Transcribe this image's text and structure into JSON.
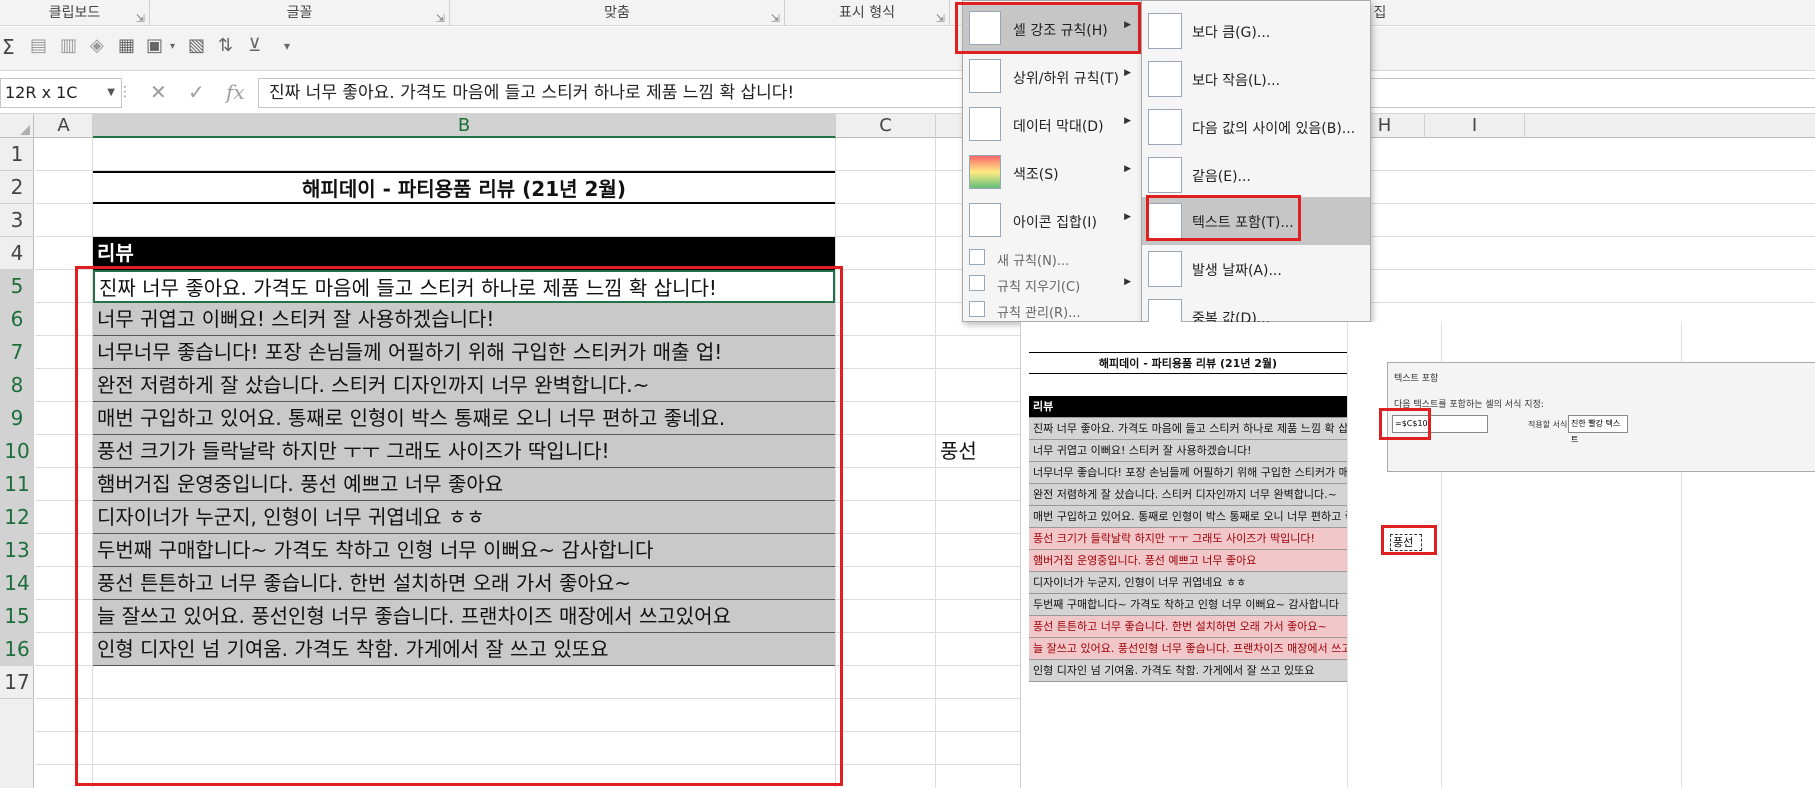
{
  "ribbon": {
    "groups": [
      "클립보드",
      "글꼴",
      "맞춤",
      "표시 형식",
      "집"
    ]
  },
  "toolbar": {
    "icons": [
      "sum-icon",
      "number-format-icon",
      "decimal-icon",
      "clear-icon",
      "format-icon",
      "merge-icon",
      "border-icon",
      "sort-icon",
      "filter-icon",
      "more-icon"
    ]
  },
  "formula_bar": {
    "name_box": "12R x 1C",
    "fx": "fx",
    "content": "진짜 너무 좋아요. 가격도 마음에 들고 스티커 하나로 제품 느낌 확 삽니다!"
  },
  "columns": [
    "A",
    "B",
    "C",
    "H",
    "I"
  ],
  "rows": [
    "1",
    "2",
    "3",
    "4",
    "5",
    "6",
    "7",
    "8",
    "9",
    "10",
    "11",
    "12",
    "13",
    "14",
    "15",
    "16",
    "17"
  ],
  "sheet": {
    "title": "해피데이 - 파티용품 리뷰 (21년 2월)",
    "header": "리뷰",
    "reviews": [
      "진짜 너무 좋아요. 가격도 마음에 들고 스티커 하나로 제품 느낌 확 삽니다!",
      "너무 귀엽고 이뻐요! 스티커 잘 사용하겠습니다!",
      "너무너무 좋습니다! 포장 손님들께 어필하기 위해 구입한 스티커가 매출 업!",
      "완전 저렴하게 잘 샀습니다. 스티커 디자인까지 너무 완벽합니다.~",
      "매번 구입하고 있어요. 통째로 인형이 박스 통째로 오니 너무 편하고 좋네요.",
      "풍선 크기가 들락날락 하지만 ㅜㅜ 그래도 사이즈가 딱입니다!",
      "햄버거집 운영중입니다. 풍선 예쁘고 너무 좋아요",
      "디자이너가 누군지, 인형이 너무 귀엽네요 ㅎㅎ",
      "두번째 구매합니다~ 가격도 착하고 인형 너무 이뻐요~ 감사합니다",
      "풍선 튼튼하고 너무 좋습니다. 한번 설치하면 오래 가서 좋아요~",
      "늘 잘쓰고 있어요. 풍선인형 너무 좋습니다. 프랜차이즈 매장에서 쓰고있어요",
      "인형 디자인 넘 기여움. 가격도 착함. 가게에서 잘 쓰고 있또요"
    ],
    "f10_value": "풍선"
  },
  "cf_menu": {
    "items": [
      {
        "label": "셀 강조 규칙(H)",
        "icon": "highlight-cells-icon"
      },
      {
        "label": "상위/하위 규칙(T)",
        "icon": "top-bottom-icon"
      },
      {
        "label": "데이터 막대(D)",
        "icon": "data-bars-icon"
      },
      {
        "label": "색조(S)",
        "icon": "color-scales-icon"
      },
      {
        "label": "아이콘 집합(I)",
        "icon": "icon-sets-icon"
      }
    ],
    "small_items": [
      "새 규칙(N)...",
      "규칙 지우기(C)",
      "규칙 관리(R)..."
    ]
  },
  "sub_menu": {
    "items": [
      {
        "label": "보다 큼(G)...",
        "icon": "greater-than-icon"
      },
      {
        "label": "보다 작음(L)...",
        "icon": "less-than-icon"
      },
      {
        "label": "다음 값의 사이에 있음(B)...",
        "icon": "between-icon"
      },
      {
        "label": "같음(E)...",
        "icon": "equal-icon"
      },
      {
        "label": "텍스트 포함(T)...",
        "icon": "text-contains-icon"
      },
      {
        "label": "발생 날짜(A)...",
        "icon": "date-occurring-icon"
      },
      {
        "label": "중복 값(D)...",
        "icon": "duplicate-values-icon"
      }
    ]
  },
  "inset": {
    "title": "해피데이 - 파티용품 리뷰 (21년 2월)",
    "header": "리뷰",
    "row_states": [
      "gray",
      "gray",
      "gray",
      "gray",
      "gray",
      "pink",
      "pink",
      "gray",
      "gray",
      "pink",
      "pink",
      "gray"
    ],
    "dialog": {
      "title": "텍스트 포함",
      "desc": "다음 텍스트를 포함하는 셀의 서식 지정:",
      "input": "=$C$10",
      "with_label": "적용할 서식:",
      "format": "진한 빨강 텍스트"
    },
    "balloon": "풍선"
  },
  "colors": {
    "accent_green": "#217346",
    "highlight_red": "#e02020",
    "pink_fill": "#f2c7c9",
    "dark_red_text": "#9c0006"
  }
}
